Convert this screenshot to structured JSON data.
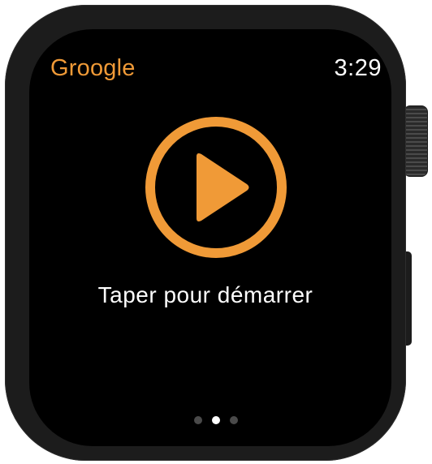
{
  "header": {
    "app_name": "Groogle",
    "time": "3:29"
  },
  "main": {
    "play_icon": "play-circle-icon",
    "hint": "Taper pour démarrer"
  },
  "pagination": {
    "total": 3,
    "current": 2
  },
  "colors": {
    "accent": "#f09a37",
    "screen": "#000000",
    "case": "#1c1c1c",
    "text": "#ffffff"
  }
}
